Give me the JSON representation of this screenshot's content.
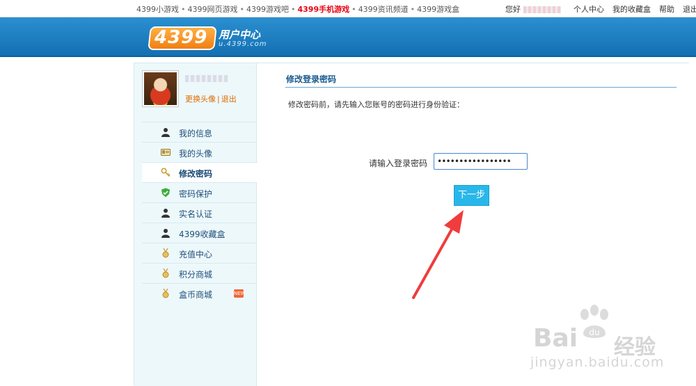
{
  "topbar": {
    "links": [
      "4399小游戏",
      "4399网页游戏",
      "4399游戏吧",
      "4399手机游戏",
      "4399资讯频道",
      "4399游戏盒"
    ],
    "separator": "•",
    "greeting": "您好",
    "right_links": [
      "个人中心",
      "我的收藏盒",
      "帮助",
      "退出"
    ],
    "hot_color": "#e60012"
  },
  "header": {
    "logo_text": "4399",
    "title": "用户中心",
    "url": "u.4399.com",
    "brand_color": "#1370b2",
    "logo_color": "#f07c10"
  },
  "profile": {
    "change_avatar": "更换头像",
    "divider": "|",
    "logout": "退出"
  },
  "sidebar": {
    "items": [
      {
        "label": "我的信息",
        "icon": "user-icon"
      },
      {
        "label": "我的头像",
        "icon": "id-card-icon"
      },
      {
        "label": "修改密码",
        "icon": "key-icon",
        "active": true
      },
      {
        "label": "密码保护",
        "icon": "shield-check-icon"
      },
      {
        "label": "实名认证",
        "icon": "user-icon"
      },
      {
        "label": "4399收藏盒",
        "icon": "user-icon"
      },
      {
        "label": "充值中心",
        "icon": "medal-icon"
      },
      {
        "label": "积分商城",
        "icon": "medal-icon"
      },
      {
        "label": "盒币商城",
        "icon": "medal-icon",
        "badge": "NEW"
      }
    ]
  },
  "main": {
    "title": "修改登录密码",
    "hint": "修改密码前，请先输入您账号的密码进行身份验证：",
    "password_label": "请输入登录密码",
    "password_value": "•••••••••••••••••",
    "next_label": "下一步",
    "button_color": "#29b7ea"
  },
  "watermark": {
    "logo": "Bai",
    "paw_text": "du",
    "brand": "经验",
    "url": "jingyan.baidu.com"
  },
  "annotation": {
    "arrow_color": "#f03c3c"
  }
}
